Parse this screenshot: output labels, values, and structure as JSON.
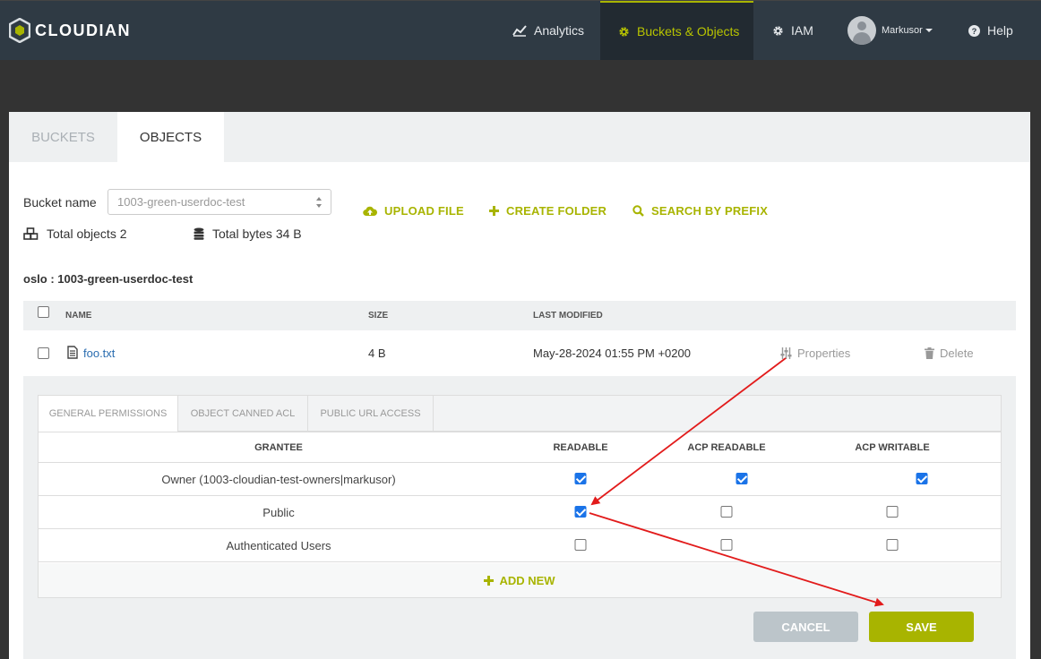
{
  "app": {
    "brand": "CLOUDIAN",
    "accent_color": "#a8b400"
  },
  "nav": {
    "analytics": "Analytics",
    "buckets_objects": "Buckets & Objects",
    "iam": "IAM",
    "user": "Markusor",
    "help": "Help"
  },
  "tabs": {
    "buckets": "BUCKETS",
    "objects": "OBJECTS",
    "active": "OBJECTS"
  },
  "bucket": {
    "label": "Bucket name",
    "selected": "1003-green-userdoc-test",
    "total_objects": "Total objects 2",
    "total_bytes": "Total bytes 34 B"
  },
  "actions": {
    "upload": "UPLOAD FILE",
    "create_folder": "CREATE FOLDER",
    "search_prefix": "SEARCH BY PREFIX"
  },
  "path": "oslo : 1003-green-userdoc-test",
  "table": {
    "columns": [
      "NAME",
      "SIZE",
      "LAST MODIFIED"
    ],
    "rows": [
      {
        "name": "foo.txt",
        "size": "4 B",
        "modified": "May-28-2024 01:55 PM +0200",
        "properties": "Properties",
        "delete": "Delete"
      }
    ]
  },
  "permissions": {
    "tabs": [
      "GENERAL PERMISSIONS",
      "OBJECT CANNED ACL",
      "PUBLIC URL ACCESS"
    ],
    "columns": [
      "GRANTEE",
      "READABLE",
      "ACP READABLE",
      "ACP WRITABLE"
    ],
    "rows": [
      {
        "grantee": "Owner (1003-cloudian-test-owners|markusor)",
        "readable": true,
        "acp_readable": true,
        "acp_writable": true
      },
      {
        "grantee": "Public",
        "readable": true,
        "acp_readable": false,
        "acp_writable": false
      },
      {
        "grantee": "Authenticated Users",
        "readable": false,
        "acp_readable": false,
        "acp_writable": false
      }
    ],
    "add_new": "ADD NEW"
  },
  "buttons": {
    "cancel": "CANCEL",
    "save": "SAVE"
  },
  "annotation_color": "#e21b1b"
}
